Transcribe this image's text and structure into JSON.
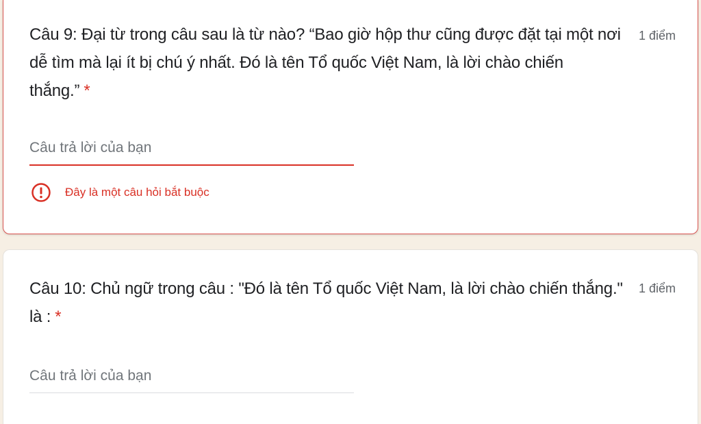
{
  "questions": [
    {
      "text": "Câu 9: Đại từ trong câu sau là từ nào? “Bao giờ hộp thư cũng được đặt tại một nơi dễ tìm mà lại ít bị chú ý nhất. Đó là tên Tổ quốc Việt Nam, là lời chào chiến thắng.”",
      "required_mark": "*",
      "points": "1 điểm",
      "answer_placeholder": "Câu trả lời của bạn",
      "answer_value": "",
      "error_message": "Đây là một câu hỏi bắt buộc",
      "error_icon": "error-circle-icon"
    },
    {
      "text": "Câu 10: Chủ ngữ trong câu : \"Đó là tên Tổ quốc Việt Nam, là lời chào chiến thắng.\" là :",
      "required_mark": "*",
      "points": "1 điểm",
      "answer_placeholder": "Câu trả lời của bạn",
      "answer_value": ""
    }
  ],
  "colors": {
    "error": "#d93025",
    "background": "#f6efe4",
    "card": "#ffffff",
    "text": "#202124"
  }
}
